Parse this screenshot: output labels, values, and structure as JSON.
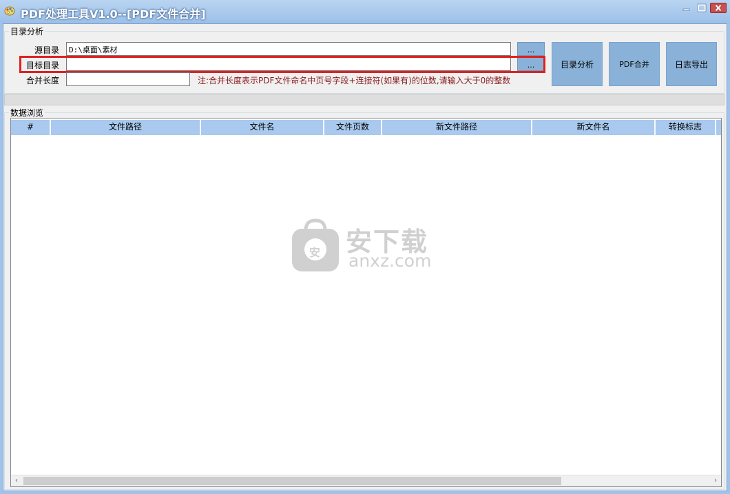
{
  "window": {
    "title": "PDF处理工具V1.0--[PDF文件合并]"
  },
  "analysis_group": {
    "label": "目录分析",
    "source_label": "源目录",
    "source_value": "D:\\桌面\\素材",
    "target_label": "目标目录",
    "target_value": "",
    "length_label": "合并长度",
    "length_value": "",
    "browse_label": "...",
    "note": "注:合并长度表示PDF文件命名中页号字段+连接符(如果有)的位数,请输入大于0的整数",
    "buttons": {
      "analyze": "目录分析",
      "merge": "PDF合并",
      "export": "日志导出"
    }
  },
  "browse_group": {
    "label": "数据浏览",
    "columns": [
      "#",
      "文件路径",
      "文件名",
      "文件页数",
      "新文件路径",
      "新文件名",
      "转换标志"
    ]
  },
  "watermark": {
    "cn": "安下载",
    "domain": "anxz.com",
    "badge": "安"
  },
  "scrollbar": {
    "left_arrow": "‹",
    "right_arrow": "›"
  },
  "colors": {
    "titlebar": "#9cc0e8",
    "button": "#8ab2d9",
    "header": "#a9c9ee",
    "highlight": "#e02020",
    "note": "#8b1a1a"
  }
}
